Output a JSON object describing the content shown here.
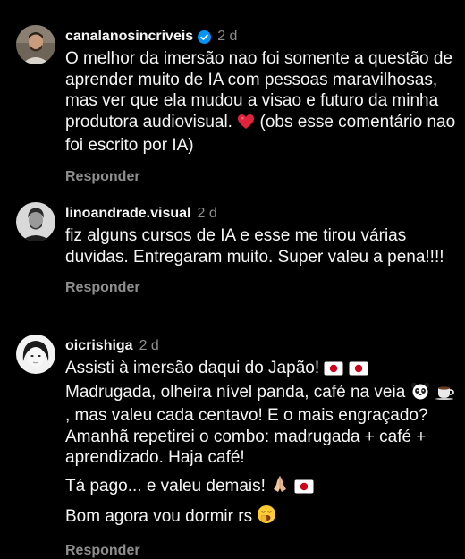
{
  "comments": [
    {
      "username": "canalanosincriveis",
      "verified": true,
      "time": "2 d",
      "text_parts": [
        "O melhor da imersão nao foi somente a questão de aprender muito de IA com pessoas maravilhosas, mas ver que ela mudou a visao e futuro da minha produtora audiovisual.",
        "(obs esse comentário nao foi escrito por IA)"
      ],
      "emoji": "heart-icon",
      "reply_label": "Responder"
    },
    {
      "username": "linoandrade.visual",
      "verified": false,
      "time": "2 d",
      "text": "fiz alguns cursos de IA e esse me tirou várias duvidas. Entregaram muito. Super valeu a pena!!!!",
      "reply_label": "Responder"
    },
    {
      "username": "oicrishiga",
      "verified": false,
      "time": "2 d",
      "paragraphs": {
        "p1_part1": "Assisti à imersão daqui do Japão!",
        "p1_part2": "Madrugada, olheira nível panda, café na veia",
        "p1_part3": ", mas valeu cada centavo! E o mais engraçado? Amanhã repetirei o combo: madrugada + café + aprendizado. Haja café!",
        "p2": "Tá pago... e valeu demais!",
        "p3": "Bom agora vou dormir rs"
      },
      "emojis": [
        "japan-flag-icon",
        "japan-flag-icon",
        "panda-icon",
        "coffee-icon",
        "praying-hands-icon",
        "japan-flag-icon",
        "yawning-face-icon"
      ],
      "reply_label": "Responder"
    }
  ],
  "colors": {
    "background": "#000000",
    "text": "#f5f5f5",
    "secondary": "#8e8e8e",
    "verified_badge": "#0095f6",
    "heart": "#e0243c"
  }
}
